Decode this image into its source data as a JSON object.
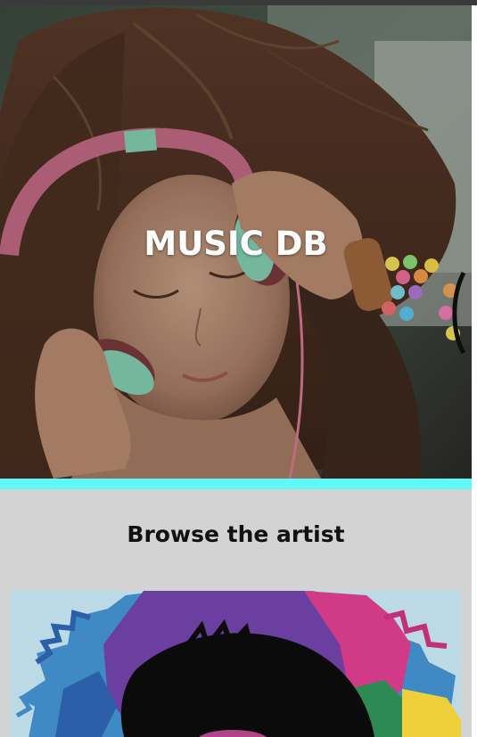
{
  "header": {
    "title": "MUSIC DB"
  },
  "hero": {
    "image": "girl-with-headphones-photo",
    "accent_color": "#5ff8f8"
  },
  "browse": {
    "heading": "Browse the artist",
    "background_color": "#d3d3d3"
  },
  "artists": [
    {
      "image": "colorful-splash-artist-art"
    }
  ],
  "colors": {
    "top_bar": "#3a3a3a",
    "accent_stripe": "#5ff8f8",
    "title_text": "#ffffff",
    "heading_text": "#111111"
  }
}
